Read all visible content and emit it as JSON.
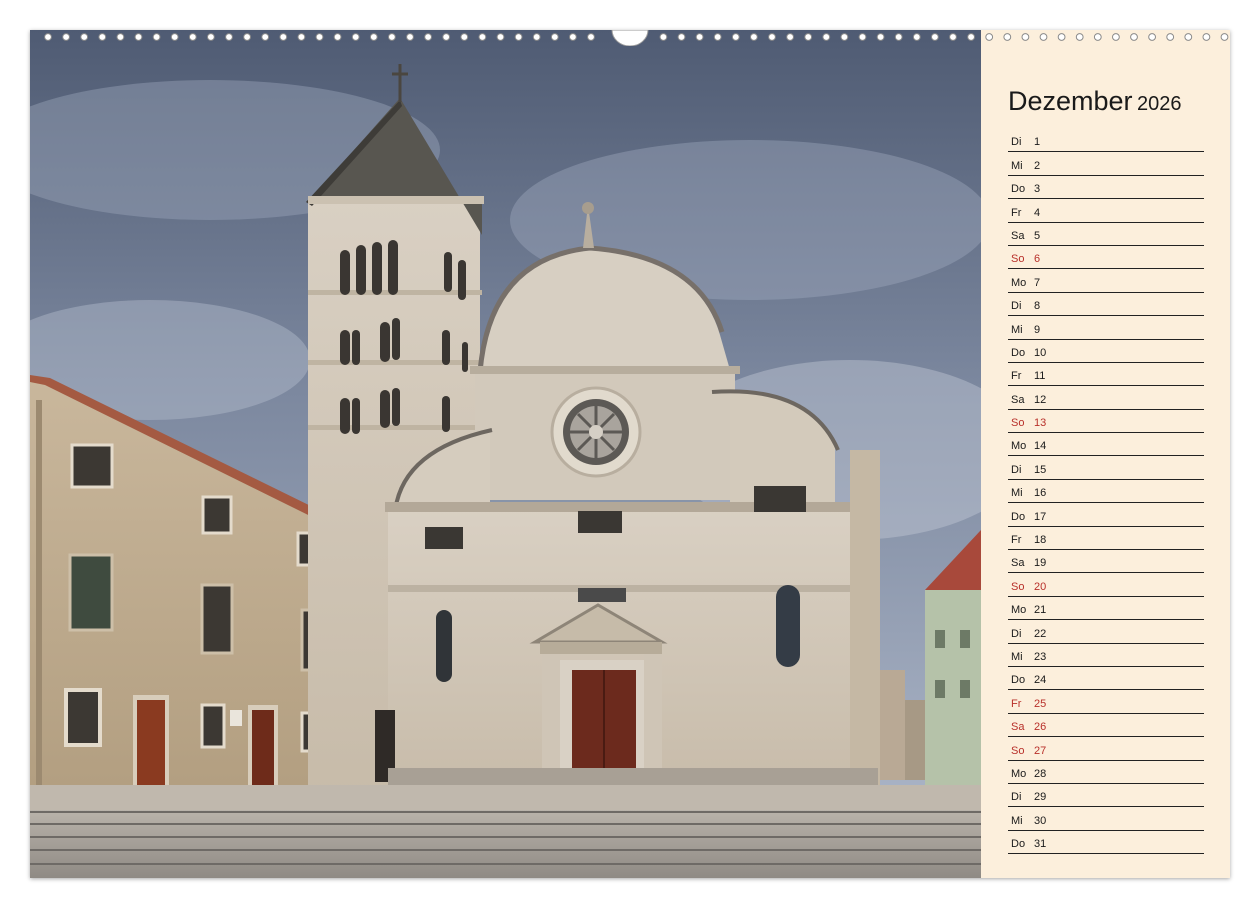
{
  "calendar": {
    "month": "Dezember",
    "year": "2026",
    "highlight_color": "#b8302a",
    "days": [
      {
        "wd": "Di",
        "d": "1",
        "red": false
      },
      {
        "wd": "Mi",
        "d": "2",
        "red": false
      },
      {
        "wd": "Do",
        "d": "3",
        "red": false
      },
      {
        "wd": "Fr",
        "d": "4",
        "red": false
      },
      {
        "wd": "Sa",
        "d": "5",
        "red": false
      },
      {
        "wd": "So",
        "d": "6",
        "red": true
      },
      {
        "wd": "Mo",
        "d": "7",
        "red": false
      },
      {
        "wd": "Di",
        "d": "8",
        "red": false
      },
      {
        "wd": "Mi",
        "d": "9",
        "red": false
      },
      {
        "wd": "Do",
        "d": "10",
        "red": false
      },
      {
        "wd": "Fr",
        "d": "11",
        "red": false
      },
      {
        "wd": "Sa",
        "d": "12",
        "red": false
      },
      {
        "wd": "So",
        "d": "13",
        "red": true
      },
      {
        "wd": "Mo",
        "d": "14",
        "red": false
      },
      {
        "wd": "Di",
        "d": "15",
        "red": false
      },
      {
        "wd": "Mi",
        "d": "16",
        "red": false
      },
      {
        "wd": "Do",
        "d": "17",
        "red": false
      },
      {
        "wd": "Fr",
        "d": "18",
        "red": false
      },
      {
        "wd": "Sa",
        "d": "19",
        "red": false
      },
      {
        "wd": "So",
        "d": "20",
        "red": true
      },
      {
        "wd": "Mo",
        "d": "21",
        "red": false
      },
      {
        "wd": "Di",
        "d": "22",
        "red": false
      },
      {
        "wd": "Mi",
        "d": "23",
        "red": false
      },
      {
        "wd": "Do",
        "d": "24",
        "red": false
      },
      {
        "wd": "Fr",
        "d": "25",
        "red": true
      },
      {
        "wd": "Sa",
        "d": "26",
        "red": true
      },
      {
        "wd": "So",
        "d": "27",
        "red": true
      },
      {
        "wd": "Mo",
        "d": "28",
        "red": false
      },
      {
        "wd": "Di",
        "d": "29",
        "red": false
      },
      {
        "wd": "Mi",
        "d": "30",
        "red": false
      },
      {
        "wd": "Do",
        "d": "31",
        "red": false
      }
    ]
  }
}
